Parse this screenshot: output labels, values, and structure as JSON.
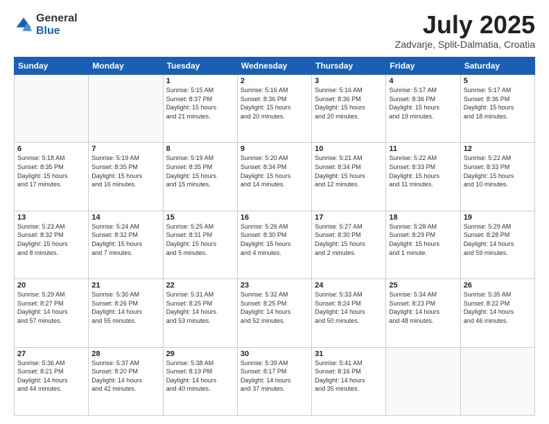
{
  "header": {
    "logo": {
      "general": "General",
      "blue": "Blue"
    },
    "title": "July 2025",
    "subtitle": "Zadvarje, Split-Dalmatia, Croatia"
  },
  "calendar": {
    "weekdays": [
      "Sunday",
      "Monday",
      "Tuesday",
      "Wednesday",
      "Thursday",
      "Friday",
      "Saturday"
    ],
    "weeks": [
      [
        {
          "day": "",
          "info": ""
        },
        {
          "day": "",
          "info": ""
        },
        {
          "day": "1",
          "info": "Sunrise: 5:15 AM\nSunset: 8:37 PM\nDaylight: 15 hours\nand 21 minutes."
        },
        {
          "day": "2",
          "info": "Sunrise: 5:16 AM\nSunset: 8:36 PM\nDaylight: 15 hours\nand 20 minutes."
        },
        {
          "day": "3",
          "info": "Sunrise: 5:16 AM\nSunset: 8:36 PM\nDaylight: 15 hours\nand 20 minutes."
        },
        {
          "day": "4",
          "info": "Sunrise: 5:17 AM\nSunset: 8:36 PM\nDaylight: 15 hours\nand 19 minutes."
        },
        {
          "day": "5",
          "info": "Sunrise: 5:17 AM\nSunset: 8:36 PM\nDaylight: 15 hours\nand 18 minutes."
        }
      ],
      [
        {
          "day": "6",
          "info": "Sunrise: 5:18 AM\nSunset: 8:35 PM\nDaylight: 15 hours\nand 17 minutes."
        },
        {
          "day": "7",
          "info": "Sunrise: 5:19 AM\nSunset: 8:35 PM\nDaylight: 15 hours\nand 16 minutes."
        },
        {
          "day": "8",
          "info": "Sunrise: 5:19 AM\nSunset: 8:35 PM\nDaylight: 15 hours\nand 15 minutes."
        },
        {
          "day": "9",
          "info": "Sunrise: 5:20 AM\nSunset: 8:34 PM\nDaylight: 15 hours\nand 14 minutes."
        },
        {
          "day": "10",
          "info": "Sunrise: 5:21 AM\nSunset: 8:34 PM\nDaylight: 15 hours\nand 12 minutes."
        },
        {
          "day": "11",
          "info": "Sunrise: 5:22 AM\nSunset: 8:33 PM\nDaylight: 15 hours\nand 11 minutes."
        },
        {
          "day": "12",
          "info": "Sunrise: 5:22 AM\nSunset: 8:33 PM\nDaylight: 15 hours\nand 10 minutes."
        }
      ],
      [
        {
          "day": "13",
          "info": "Sunrise: 5:23 AM\nSunset: 8:32 PM\nDaylight: 15 hours\nand 8 minutes."
        },
        {
          "day": "14",
          "info": "Sunrise: 5:24 AM\nSunset: 8:32 PM\nDaylight: 15 hours\nand 7 minutes."
        },
        {
          "day": "15",
          "info": "Sunrise: 5:25 AM\nSunset: 8:31 PM\nDaylight: 15 hours\nand 5 minutes."
        },
        {
          "day": "16",
          "info": "Sunrise: 5:26 AM\nSunset: 8:30 PM\nDaylight: 15 hours\nand 4 minutes."
        },
        {
          "day": "17",
          "info": "Sunrise: 5:27 AM\nSunset: 8:30 PM\nDaylight: 15 hours\nand 2 minutes."
        },
        {
          "day": "18",
          "info": "Sunrise: 5:28 AM\nSunset: 8:29 PM\nDaylight: 15 hours\nand 1 minute."
        },
        {
          "day": "19",
          "info": "Sunrise: 5:29 AM\nSunset: 8:28 PM\nDaylight: 14 hours\nand 59 minutes."
        }
      ],
      [
        {
          "day": "20",
          "info": "Sunrise: 5:29 AM\nSunset: 8:27 PM\nDaylight: 14 hours\nand 57 minutes."
        },
        {
          "day": "21",
          "info": "Sunrise: 5:30 AM\nSunset: 8:26 PM\nDaylight: 14 hours\nand 55 minutes."
        },
        {
          "day": "22",
          "info": "Sunrise: 5:31 AM\nSunset: 8:25 PM\nDaylight: 14 hours\nand 53 minutes."
        },
        {
          "day": "23",
          "info": "Sunrise: 5:32 AM\nSunset: 8:25 PM\nDaylight: 14 hours\nand 52 minutes."
        },
        {
          "day": "24",
          "info": "Sunrise: 5:33 AM\nSunset: 8:24 PM\nDaylight: 14 hours\nand 50 minutes."
        },
        {
          "day": "25",
          "info": "Sunrise: 5:34 AM\nSunset: 8:23 PM\nDaylight: 14 hours\nand 48 minutes."
        },
        {
          "day": "26",
          "info": "Sunrise: 5:35 AM\nSunset: 8:22 PM\nDaylight: 14 hours\nand 46 minutes."
        }
      ],
      [
        {
          "day": "27",
          "info": "Sunrise: 5:36 AM\nSunset: 8:21 PM\nDaylight: 14 hours\nand 44 minutes."
        },
        {
          "day": "28",
          "info": "Sunrise: 5:37 AM\nSunset: 8:20 PM\nDaylight: 14 hours\nand 42 minutes."
        },
        {
          "day": "29",
          "info": "Sunrise: 5:38 AM\nSunset: 8:19 PM\nDaylight: 14 hours\nand 40 minutes."
        },
        {
          "day": "30",
          "info": "Sunrise: 5:39 AM\nSunset: 8:17 PM\nDaylight: 14 hours\nand 37 minutes."
        },
        {
          "day": "31",
          "info": "Sunrise: 5:41 AM\nSunset: 8:16 PM\nDaylight: 14 hours\nand 35 minutes."
        },
        {
          "day": "",
          "info": ""
        },
        {
          "day": "",
          "info": ""
        }
      ]
    ]
  }
}
